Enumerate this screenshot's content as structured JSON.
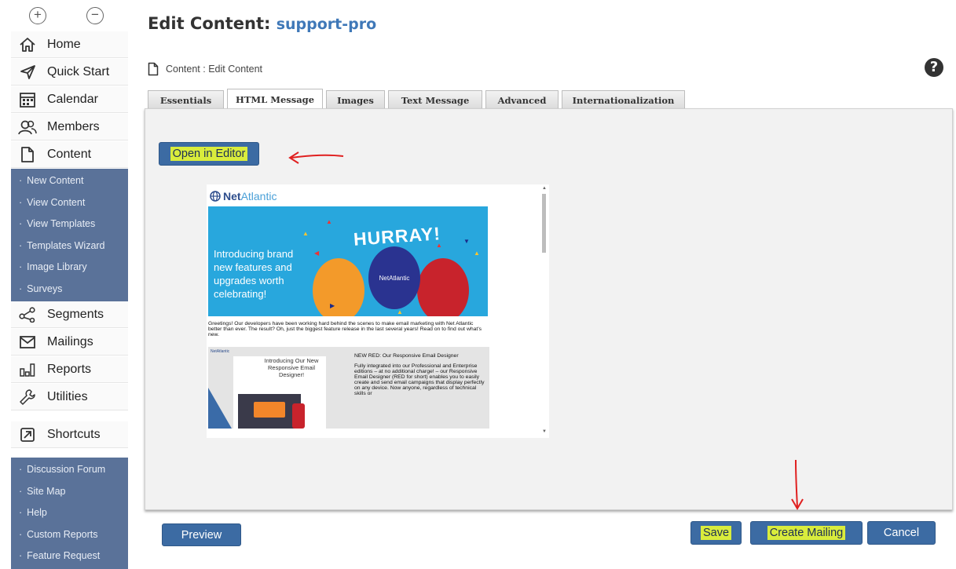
{
  "page": {
    "title_prefix": "Edit Content:",
    "account_name": "support-pro",
    "breadcrumb": "Content : Edit Content",
    "help_symbol": "?"
  },
  "sidebar": {
    "zoom_in": "+",
    "zoom_out": "−",
    "items": [
      {
        "label": "Home",
        "icon": "home-icon"
      },
      {
        "label": "Quick Start",
        "icon": "paper-plane-icon"
      },
      {
        "label": "Calendar",
        "icon": "calendar-icon"
      },
      {
        "label": "Members",
        "icon": "members-icon"
      },
      {
        "label": "Content",
        "icon": "document-icon"
      }
    ],
    "content_submenu": [
      "New Content",
      "View Content",
      "View Templates",
      "Templates Wizard",
      "Image Library",
      "Surveys"
    ],
    "items2": [
      {
        "label": "Segments",
        "icon": "share-icon"
      },
      {
        "label": "Mailings",
        "icon": "envelope-icon"
      },
      {
        "label": "Reports",
        "icon": "bar-chart-icon"
      },
      {
        "label": "Utilities",
        "icon": "wrench-icon"
      }
    ],
    "shortcuts": {
      "label": "Shortcuts",
      "icon": "arrow-up-right-icon"
    },
    "shortcut_links": [
      "Discussion Forum",
      "Site Map",
      "Help",
      "Custom Reports",
      "Feature Request"
    ]
  },
  "tabs": [
    "Essentials",
    "HTML Message",
    "Images",
    "Text Message",
    "Advanced",
    "Internationalization"
  ],
  "active_tab": "HTML Message",
  "editor": {
    "open_button": "Open in Editor"
  },
  "email_preview": {
    "brand_net": "Net",
    "brand_atlantic": "Atlantic",
    "hero_text": "Introducing brand new features and upgrades worth celebrating!",
    "hurray": "HURRAY!",
    "balloon_brand": "NetAtlantic",
    "body_text": "Greetings! Our developers have been working hard behind the scenes to make email marketing with Net Atlantic better than ever. The result? Oh, just the biggest feature release in the last several years! Read on to find out what's new.",
    "promo_brand": "NetAtlantic",
    "promo_left_title": "Introducing Our New Responsive Email Designer!",
    "promo_title": "NEW RED: Our Responsive Email Designer",
    "promo_text": "Fully integrated into our Professional and Enterprise editions – at no additional charge! – our Responsive Email Designer (RED for short) enables you to easily create and send email campaigns that display perfectly on any device. Now anyone, regardless of technical skills or"
  },
  "buttons": {
    "preview": "Preview",
    "save": "Save",
    "create_mailing": "Create Mailing",
    "cancel": "Cancel"
  },
  "colors": {
    "sidebar_submenu": "#5a7299",
    "button_blue": "#3c6ba3",
    "highlight": "#d9ec3c",
    "annotation_red": "#e02020",
    "hero_blue": "#28a7dd"
  }
}
